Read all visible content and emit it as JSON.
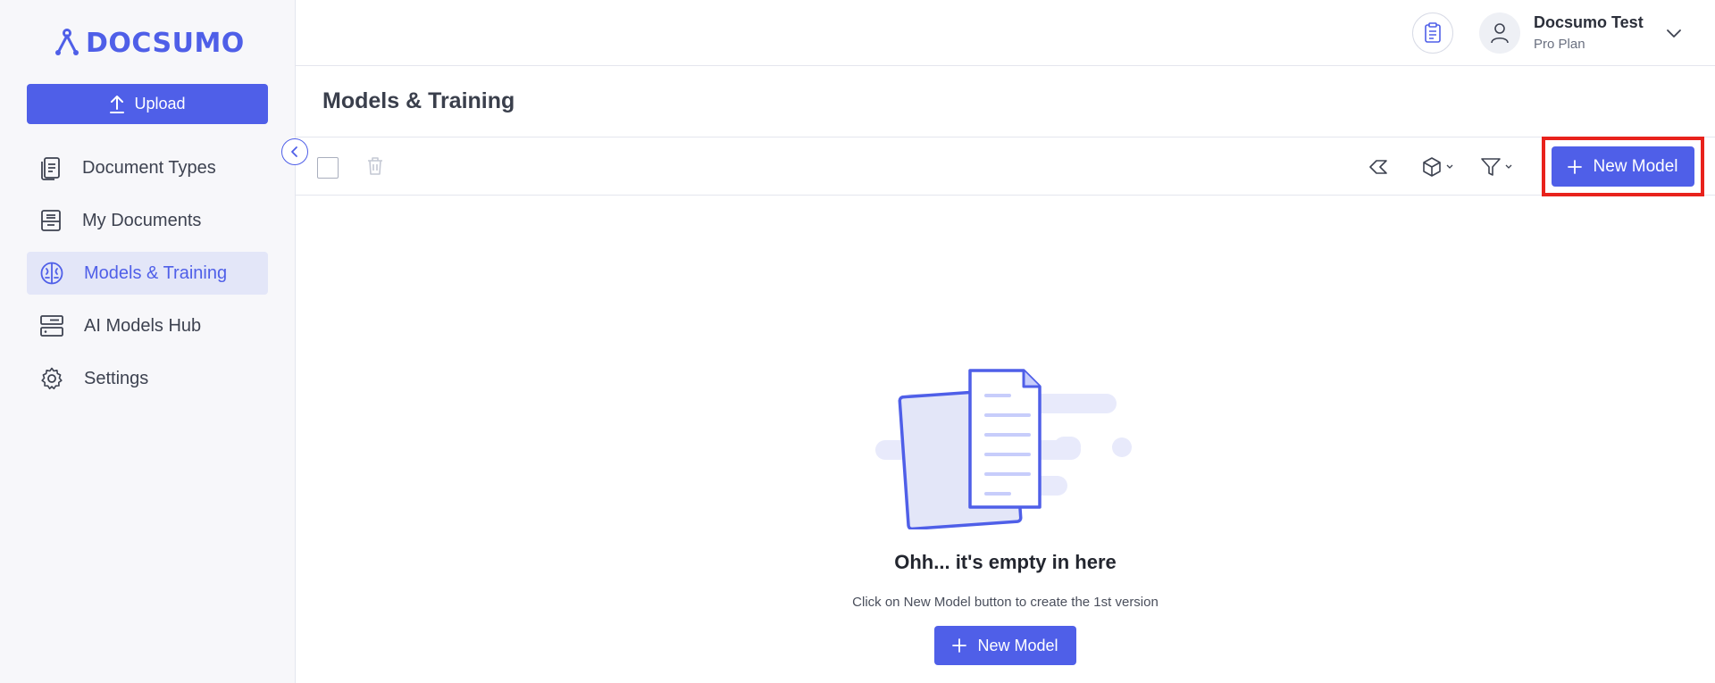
{
  "brand": {
    "name": "DOCSUMO",
    "color": "#4f5fe8"
  },
  "sidebar": {
    "upload_label": "Upload",
    "items": [
      {
        "label": "Document Types",
        "icon": "document-types-icon",
        "active": false
      },
      {
        "label": "My Documents",
        "icon": "my-documents-icon",
        "active": false
      },
      {
        "label": "Models & Training",
        "icon": "brain-icon",
        "active": true
      },
      {
        "label": "AI Models Hub",
        "icon": "server-icon",
        "active": false
      },
      {
        "label": "Settings",
        "icon": "gear-icon",
        "active": false
      }
    ]
  },
  "header": {
    "user_name": "Docsumo Test",
    "user_plan": "Pro Plan"
  },
  "page": {
    "title": "Models & Training"
  },
  "toolbar": {
    "new_model_label": "New Model"
  },
  "empty_state": {
    "title": "Ohh... it's empty in here",
    "subtitle": "Click on New Model button to create the 1st version",
    "button_label": "New Model"
  },
  "colors": {
    "accent": "#4f5fe8",
    "highlight": "#e8221c",
    "active_bg": "#e3e6f8"
  }
}
